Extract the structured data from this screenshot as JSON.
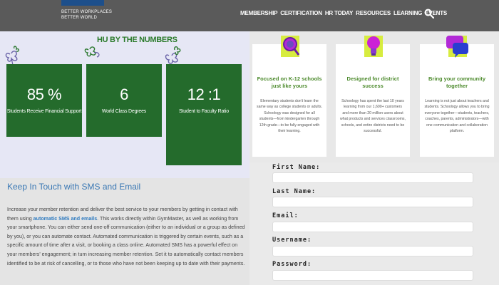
{
  "header": {
    "logo_text": "SHRM",
    "tagline_line1": "BETTER WORKPLACES",
    "tagline_line2": "BETTER WORLD",
    "nav": [
      "MEMBERSHIP",
      "CERTIFICATION",
      "HR TODAY",
      "RESOURCES",
      "LEARNING",
      "EVENTS"
    ],
    "search_icon": "search-icon"
  },
  "stats": {
    "heading": "HU BY THE NUMBERS",
    "cards": [
      {
        "value": "85 %",
        "label": "Students Receive Financial Support"
      },
      {
        "value": "6",
        "label": "World Class Degrees"
      },
      {
        "value": "12 :1",
        "label": "Student to Faculty Ratio"
      }
    ],
    "card_color": "#246b2c",
    "heading_color": "#2a7a2a"
  },
  "features": [
    {
      "icon": "magnifier-icon",
      "title": "Focused on K-12 schools just like yours",
      "desc": "Elementary students don't learn the same way as college students or adults. Schoology was designed for all students—from kindergarten through 12th grade—to be fully engaged with their learning."
    },
    {
      "icon": "lightbulb-icon",
      "title": "Designed for district success",
      "desc": "Schoology has spent the last 10 years learning from our 1,600+ customers and more than 20 million users about what products and services classrooms, schools, and entire districts need to be successful."
    },
    {
      "icon": "chat-bubbles-icon",
      "title": "Bring your community together",
      "desc": "Learning is not just about teachers and students. Schoology allows you to bring everyone together—students, teachers, coaches, parents, administrators—with one communication and collaboration platform."
    }
  ],
  "sms": {
    "title": "Keep In Touch with SMS and Email",
    "body_before": "Increase your member retention and deliver the best service to your members by getting in contact with them using ",
    "body_link": "automatic SMS and emails",
    "body_after": ". This works directly within GymMaster, as well as working from your smartphone. You can either send one-off communication (either to an individual or a group as defined by you), or you can automate contact. Automated communication is triggered by certain events, such as a specific amount of time after a visit, or booking a class online. Automated SMS has a powerful effect on your members' engagement; in turn increasing member retention. Set it to automatically contact members identified to be at risk of cancelling, or to those who have not been keeping up to date with their payments."
  },
  "form": {
    "fields": [
      {
        "label": "First Name:",
        "value": ""
      },
      {
        "label": "Last Name:",
        "value": ""
      },
      {
        "label": "Email:",
        "value": ""
      },
      {
        "label": "Username:",
        "value": ""
      },
      {
        "label": "Password:",
        "value": ""
      }
    ]
  }
}
